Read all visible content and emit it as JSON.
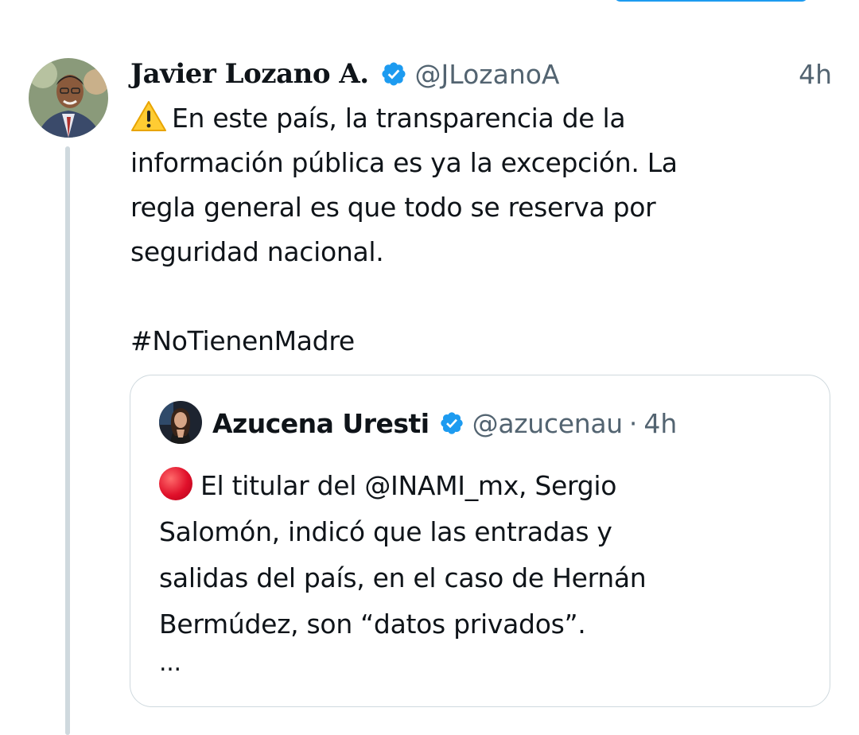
{
  "tweet": {
    "author_name": "Javier Lozano A.",
    "handle": "@JLozanoA",
    "time": "4h",
    "warning_icon": "warning-sign-icon",
    "lines": [
      "En este país, la transparencia de la",
      "información pública es ya la excepción. La",
      "regla general es que todo se reserva por",
      "seguridad nacional."
    ],
    "hashtag": "#NoTienenMadre"
  },
  "quote": {
    "author_name": "Azucena Uresti",
    "handle": "@azucenau",
    "separator": "·",
    "time": "4h",
    "bullet_icon": "red-circle-icon",
    "lines": [
      "El titular del @INAMI_mx, Sergio",
      "Salomón, indicó que las entradas y",
      "salidas del país, en el caso de Hernán",
      "Bermúdez, son “datos privados”."
    ],
    "truncation": "..."
  },
  "colors": {
    "verified_badge": "#1d9bf0",
    "secondary_text": "#536471",
    "thread_line": "#cfd9de",
    "card_border": "#cfd9de"
  }
}
